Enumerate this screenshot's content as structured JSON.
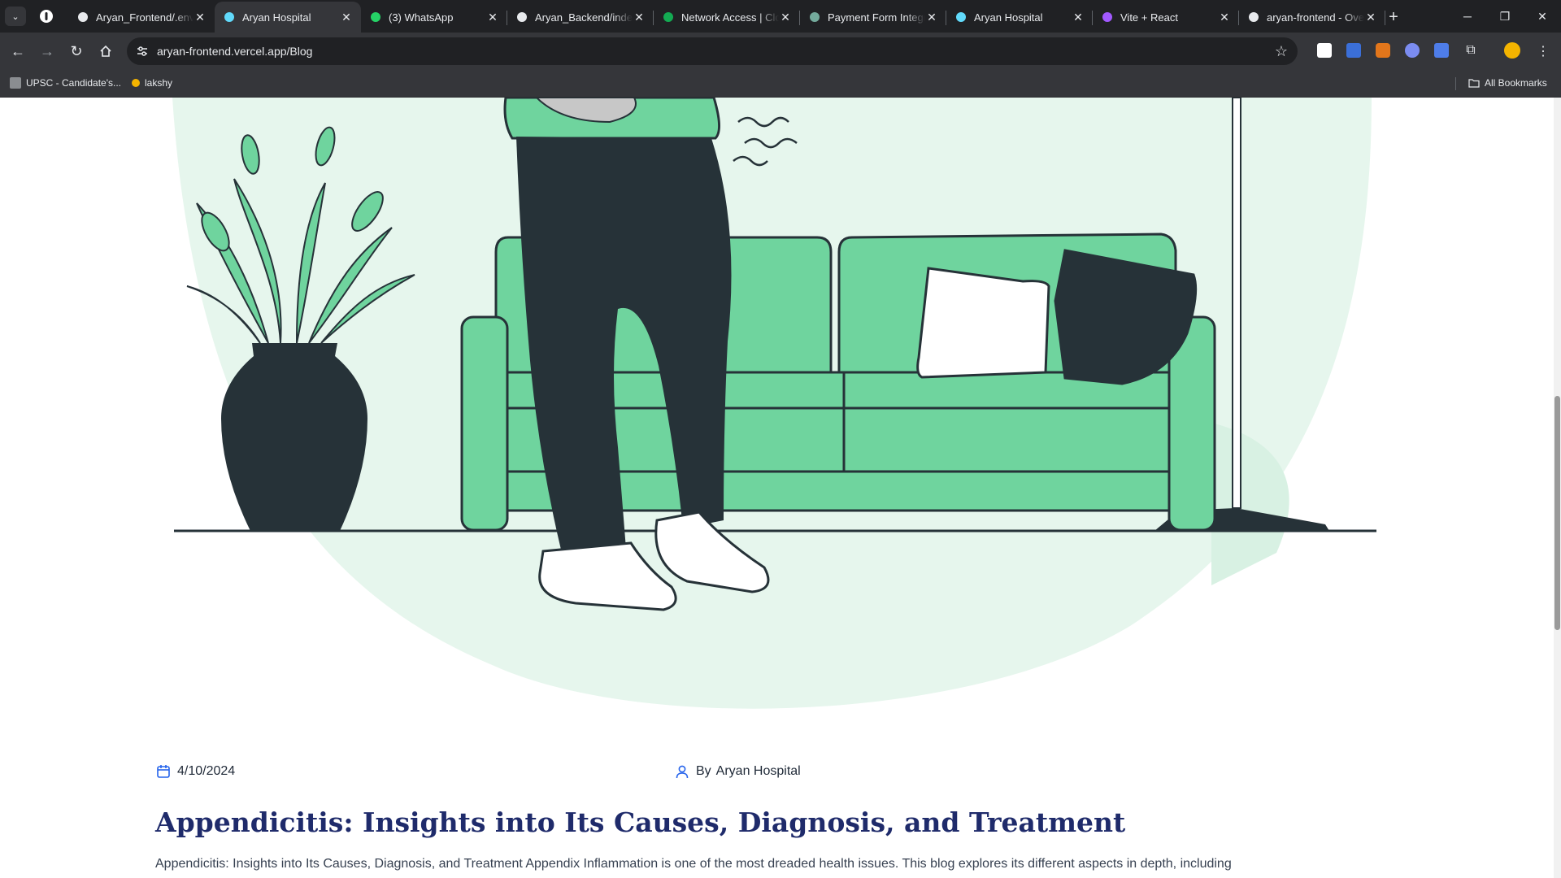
{
  "browser": {
    "tabs": [
      {
        "title": "Aryan_Frontend/.env",
        "icon": "github-icon",
        "active": false
      },
      {
        "title": "Aryan Hospital",
        "icon": "react-icon",
        "active": true
      },
      {
        "title": "(3) WhatsApp",
        "icon": "whatsapp-icon",
        "active": false
      },
      {
        "title": "Aryan_Backend/index",
        "icon": "github-icon",
        "active": false
      },
      {
        "title": "Network Access | Cloud",
        "icon": "mongodb-leaf-icon",
        "active": false
      },
      {
        "title": "Payment Form Integration",
        "icon": "chatgpt-icon",
        "active": false
      },
      {
        "title": "Aryan Hospital",
        "icon": "react-icon",
        "active": false
      },
      {
        "title": "Vite + React",
        "icon": "vite-icon",
        "active": false
      },
      {
        "title": "aryan-frontend - Overview",
        "icon": "vercel-icon",
        "active": false
      }
    ],
    "url": "aryan-frontend.vercel.app/Blog",
    "bookmarks": [
      {
        "label": "UPSC - Candidate's...",
        "icon": "upsc-icon"
      },
      {
        "label": "lakshy",
        "icon": "lakshy-icon"
      }
    ],
    "all_bookmarks_label": "All Bookmarks",
    "colors": {
      "frame": "#202124",
      "toolbar": "#35363a",
      "text": "#e8eaed"
    }
  },
  "blog": {
    "date": "4/10/2024",
    "author_prefix": "By",
    "author": "Aryan Hospital",
    "title": "Appendicitis: Insights into Its Causes, Diagnosis, and Treatment",
    "excerpt": "Appendicitis: Insights into Its Causes, Diagnosis, and Treatment Appendix Inflammation is one of the most dreaded health issues. This blog explores its different aspects in depth, including",
    "colors": {
      "title": "#1f2b6b",
      "accent_green": "#6fd49e",
      "dark": "#263238"
    }
  }
}
